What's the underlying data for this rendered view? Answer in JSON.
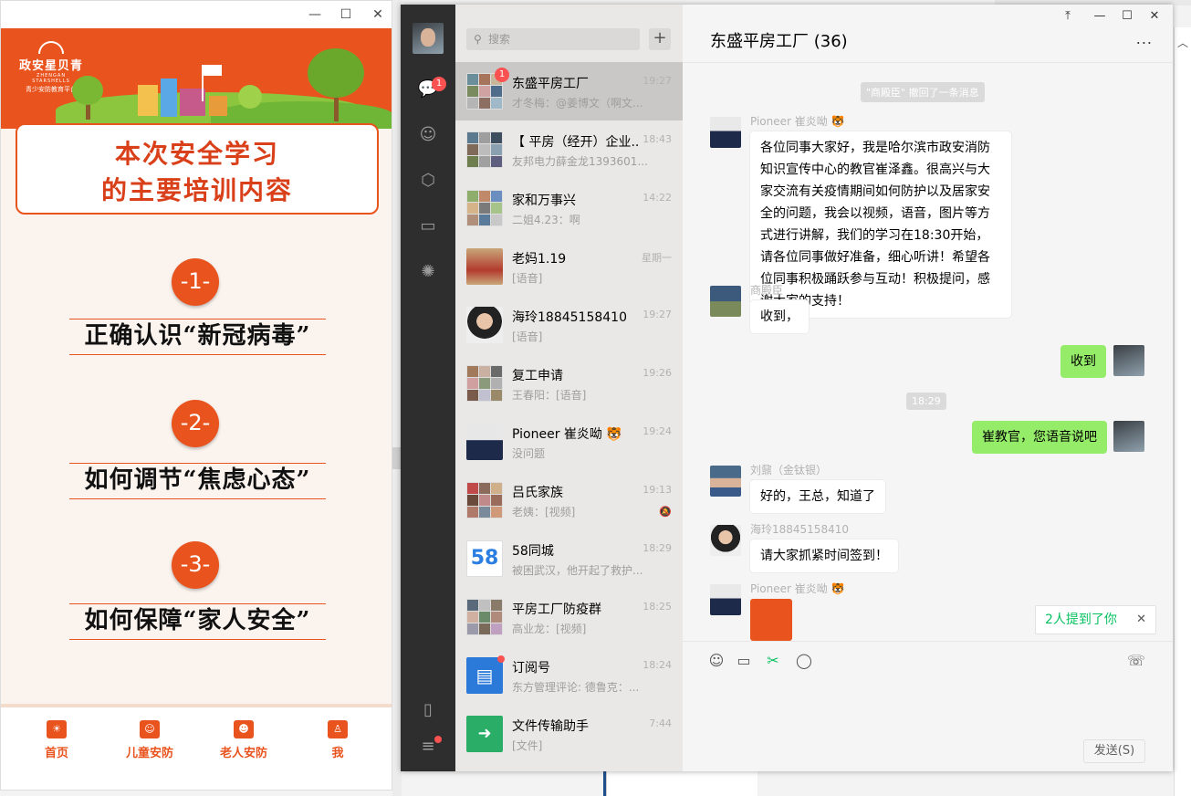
{
  "mini_app": {
    "brand_name": "政安星贝青",
    "brand_en": "ZHENGAN STARSHELLS",
    "brand_sub": "青少安防教育平台",
    "title_line1": "本次安全学习",
    "title_line2": "的主要培训内容",
    "steps": [
      {
        "badge": "-1-",
        "title": "正确认识“新冠病毒”"
      },
      {
        "badge": "-2-",
        "title": "如何调节“焦虑心态”"
      },
      {
        "badge": "-3-",
        "title": "如何保障“家人安全”"
      }
    ],
    "tabs": [
      {
        "label": "首页"
      },
      {
        "label": "儿童安防"
      },
      {
        "label": "老人安防"
      },
      {
        "label": "我"
      }
    ]
  },
  "wechat": {
    "search_placeholder": "搜索",
    "chats_badge": "1",
    "conversations": [
      {
        "name": "东盛平房工厂",
        "time": "19:27",
        "preview": "才冬梅：@姜博文（啊文...",
        "badge": "1"
      },
      {
        "name": "【 平房（经开）企业...",
        "time": "18:43",
        "preview": "友邦电力薛金龙1393601..."
      },
      {
        "name": "家和万事兴",
        "time": "14:22",
        "preview": "二姐4.23：啊"
      },
      {
        "name": "老妈1.19",
        "time": "星期一",
        "preview": "[语音]"
      },
      {
        "name": "海玲18845158410",
        "time": "19:27",
        "preview": "[语音]"
      },
      {
        "name": "复工申请",
        "time": "19:26",
        "preview": "王春阳：[语音]"
      },
      {
        "name": "Pioneer 崔炎呦 🐯",
        "time": "19:24",
        "preview": "没问题"
      },
      {
        "name": "吕氏家族",
        "time": "19:13",
        "preview": "老姨：[视频]"
      },
      {
        "name": "58同城",
        "time": "18:29",
        "preview": "被困武汉，他开起了救护..."
      },
      {
        "name": "平房工厂防疫群",
        "time": "18:25",
        "preview": "高业龙：[视频]"
      },
      {
        "name": "订阅号",
        "time": "18:24",
        "preview": "东方管理评论: 德鲁克：..."
      },
      {
        "name": "文件传输助手",
        "time": "7:44",
        "preview": "[文件]"
      }
    ],
    "av_58": "58",
    "chat_title": "东盛平房工厂 (36)",
    "more": "...",
    "recall_tip": "\"商殿臣\" 撤回了一条消息",
    "time_tip": "18:29",
    "messages": [
      {
        "nick": "Pioneer 崔炎呦 🐯",
        "text": "各位同事大家好，我是哈尔滨市政安消防知识宣传中心的教官崔泽鑫。很高兴与大家交流有关疫情期间如何防护以及居家安全的问题，我会以视频，语音，图片等方式进行讲解，我们的学习在18:30开始，请各位同事做好准备，细心听讲！希望各位同事积极踊跃参与互动！积极提问，感谢大家的支持！"
      },
      {
        "nick": "商殿臣",
        "text": "收到，"
      },
      {
        "nick": "",
        "text": "收到"
      },
      {
        "nick": "",
        "text": "崔教官，您语音说吧"
      },
      {
        "nick": "刘鼐（金钛银）",
        "text": "好的，王总，知道了"
      },
      {
        "nick": "海玲18845158410",
        "text": "请大家抓紧时间签到！"
      },
      {
        "nick": "Pioneer 崔炎呦 🐯",
        "text": ""
      }
    ],
    "mention_tip": "2人提到了你",
    "send_label": "发送(S)"
  }
}
